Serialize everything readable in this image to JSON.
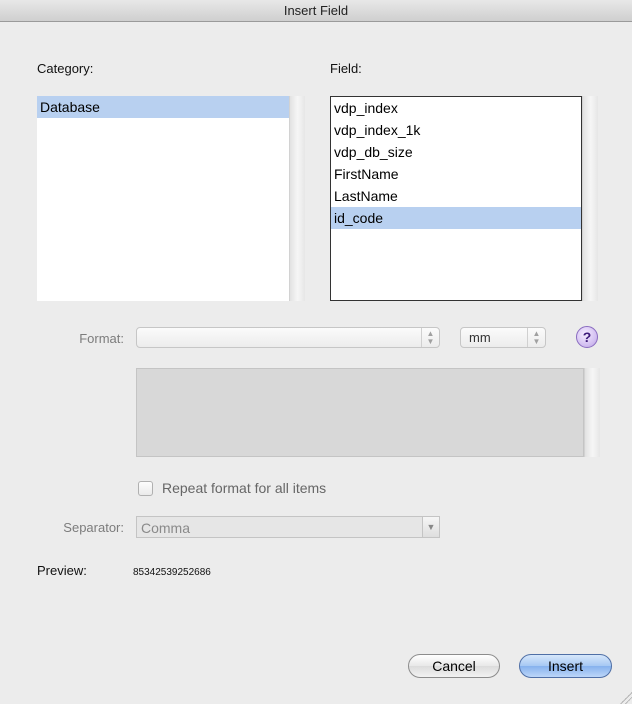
{
  "window": {
    "title": "Insert Field"
  },
  "category": {
    "label": "Category:",
    "items": [
      {
        "label": "Database",
        "selected": true
      }
    ]
  },
  "field": {
    "label": "Field:",
    "items": [
      {
        "label": "vdp_index",
        "selected": false
      },
      {
        "label": "vdp_index_1k",
        "selected": false
      },
      {
        "label": "vdp_db_size",
        "selected": false
      },
      {
        "label": "FirstName",
        "selected": false
      },
      {
        "label": "LastName",
        "selected": false
      },
      {
        "label": "id_code",
        "selected": true
      }
    ]
  },
  "format": {
    "label": "Format:",
    "value": "",
    "unit": "mm",
    "help": "?"
  },
  "repeat": {
    "label": "Repeat format for all items",
    "checked": false
  },
  "separator": {
    "label": "Separator:",
    "value": "Comma"
  },
  "preview": {
    "label": "Preview:",
    "value": "85342539252686"
  },
  "buttons": {
    "cancel": "Cancel",
    "insert": "Insert"
  },
  "colors": {
    "selection": "#b8d0f0",
    "default_button": "#86b2ee",
    "help": "#d5c2f2"
  }
}
